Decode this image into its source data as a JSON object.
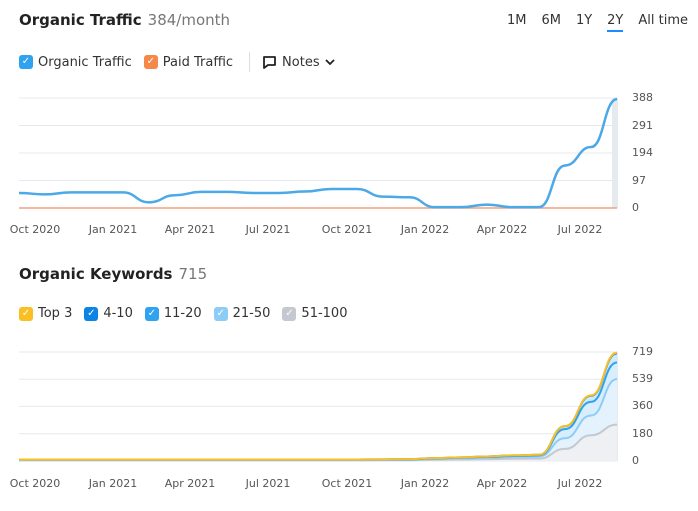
{
  "traffic": {
    "title": "Organic Traffic",
    "subtitle": "384/month",
    "legend": [
      {
        "label": "Organic Traffic",
        "color": "#2fa3f0",
        "checked": true
      },
      {
        "label": "Paid Traffic",
        "color": "#f5894a",
        "checked": true
      }
    ],
    "notes_label": "Notes"
  },
  "periods": [
    "1M",
    "6M",
    "1Y",
    "2Y",
    "All time"
  ],
  "active_period": "2Y",
  "keywords": {
    "title": "Organic Keywords",
    "subtitle": "715",
    "legend": [
      {
        "label": "Top 3",
        "color": "#fbbf24",
        "checked": true
      },
      {
        "label": "4-10",
        "color": "#0b84e6",
        "checked": true
      },
      {
        "label": "11-20",
        "color": "#2fa3f0",
        "checked": true
      },
      {
        "label": "21-50",
        "color": "#8ccdf7",
        "checked": true
      },
      {
        "label": "51-100",
        "color": "#c4c8d0",
        "checked": true
      }
    ]
  },
  "chart_data": [
    {
      "type": "line",
      "title": "Organic Traffic",
      "x": [
        "Sep 2020",
        "Oct 2020",
        "Nov 2020",
        "Dec 2020",
        "Jan 2021",
        "Feb 2021",
        "Mar 2021",
        "Apr 2021",
        "May 2021",
        "Jun 2021",
        "Jul 2021",
        "Aug 2021",
        "Sep 2021",
        "Oct 2021",
        "Nov 2021",
        "Dec 2021",
        "Jan 2022",
        "Feb 2022",
        "Mar 2022",
        "Apr 2022",
        "May 2022",
        "Jun 2022",
        "Jul 2022",
        "Aug 2022"
      ],
      "x_ticks": [
        "Oct 2020",
        "Jan 2021",
        "Apr 2021",
        "Jul 2021",
        "Oct 2021",
        "Jan 2022",
        "Apr 2022",
        "Jul 2022"
      ],
      "y_ticks": [
        0,
        97,
        194,
        291,
        388
      ],
      "ylim": [
        0,
        388
      ],
      "grid": true,
      "series": [
        {
          "name": "Organic Traffic",
          "color": "#4aa9e6",
          "values": [
            53,
            48,
            55,
            55,
            55,
            20,
            45,
            57,
            57,
            53,
            53,
            58,
            67,
            67,
            40,
            38,
            3,
            3,
            12,
            3,
            3,
            150,
            215,
            384
          ]
        },
        {
          "name": "Paid Traffic",
          "color": "#f0a080",
          "values": [
            0,
            0,
            0,
            0,
            0,
            0,
            0,
            0,
            0,
            0,
            0,
            0,
            0,
            0,
            0,
            0,
            0,
            0,
            0,
            0,
            0,
            0,
            0,
            0
          ]
        }
      ]
    },
    {
      "type": "area",
      "title": "Organic Keywords",
      "x": [
        "Sep 2020",
        "Oct 2020",
        "Nov 2020",
        "Dec 2020",
        "Jan 2021",
        "Feb 2021",
        "Mar 2021",
        "Apr 2021",
        "May 2021",
        "Jun 2021",
        "Jul 2021",
        "Aug 2021",
        "Sep 2021",
        "Oct 2021",
        "Nov 2021",
        "Dec 2021",
        "Jan 2022",
        "Feb 2022",
        "Mar 2022",
        "Apr 2022",
        "May 2022",
        "Jun 2022",
        "Jul 2022",
        "Aug 2022"
      ],
      "x_ticks": [
        "Oct 2020",
        "Jan 2021",
        "Apr 2021",
        "Jul 2021",
        "Oct 2021",
        "Jan 2022",
        "Apr 2022",
        "Jul 2022"
      ],
      "y_ticks": [
        0,
        180,
        360,
        539,
        719
      ],
      "ylim": [
        0,
        719
      ],
      "grid": true,
      "stacked": true,
      "series": [
        {
          "name": "Top 3",
          "color": "#fbbf24",
          "values": [
            0,
            0,
            0,
            0,
            0,
            0,
            0,
            0,
            0,
            0,
            0,
            0,
            0,
            0,
            0,
            0,
            0,
            0,
            0,
            0,
            0,
            0,
            3,
            5
          ]
        },
        {
          "name": "4-10",
          "color": "#0b84e6",
          "values": [
            1,
            1,
            1,
            1,
            1,
            1,
            1,
            1,
            1,
            1,
            1,
            1,
            1,
            1,
            1,
            1,
            2,
            2,
            3,
            4,
            4,
            20,
            40,
            60
          ]
        },
        {
          "name": "11-20",
          "color": "#2fa3f0",
          "values": [
            2,
            2,
            2,
            2,
            2,
            2,
            2,
            2,
            2,
            2,
            2,
            2,
            2,
            2,
            2,
            2,
            3,
            4,
            5,
            6,
            7,
            60,
            90,
            110
          ]
        },
        {
          "name": "21-50",
          "color": "#8ccdf7",
          "values": [
            3,
            3,
            3,
            3,
            3,
            3,
            3,
            3,
            3,
            3,
            3,
            3,
            3,
            3,
            3,
            4,
            6,
            8,
            10,
            12,
            14,
            70,
            130,
            300
          ]
        },
        {
          "name": "51-100",
          "color": "#c4c8d0",
          "values": [
            4,
            4,
            4,
            4,
            4,
            4,
            4,
            4,
            4,
            4,
            4,
            4,
            4,
            4,
            5,
            5,
            8,
            10,
            12,
            15,
            16,
            80,
            170,
            240
          ]
        }
      ]
    }
  ]
}
